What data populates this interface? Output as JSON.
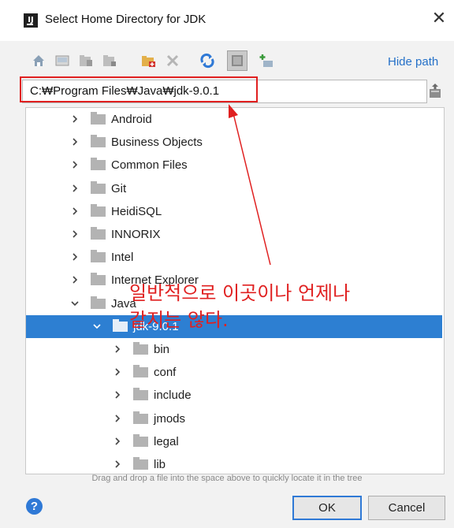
{
  "window": {
    "title": "Select Home Directory for JDK",
    "app_icon_text": "IJ",
    "close_glyph": "✕"
  },
  "toolbar": {
    "icons": [
      "home-icon",
      "desktop-icon",
      "project-icon",
      "module-icon",
      "new-folder-icon",
      "delete-icon",
      "refresh-icon",
      "show-hidden-icon",
      "expand-icon"
    ],
    "hide_path_label": "Hide path"
  },
  "path": {
    "value": "C:₩Program Files₩Java₩jdk-9.0.1"
  },
  "tree": {
    "items": [
      {
        "label": "Android",
        "level": 0,
        "expanded": false
      },
      {
        "label": "Business Objects",
        "level": 0,
        "expanded": false
      },
      {
        "label": "Common Files",
        "level": 0,
        "expanded": false
      },
      {
        "label": "Git",
        "level": 0,
        "expanded": false
      },
      {
        "label": "HeidiSQL",
        "level": 0,
        "expanded": false
      },
      {
        "label": "INNORIX",
        "level": 0,
        "expanded": false
      },
      {
        "label": "Intel",
        "level": 0,
        "expanded": false
      },
      {
        "label": "Internet Explorer",
        "level": 0,
        "expanded": false
      },
      {
        "label": "Java",
        "level": 0,
        "expanded": true
      },
      {
        "label": "jdk-9.0.1",
        "level": 1,
        "expanded": true,
        "selected": true
      },
      {
        "label": "bin",
        "level": 2,
        "expanded": false
      },
      {
        "label": "conf",
        "level": 2,
        "expanded": false
      },
      {
        "label": "include",
        "level": 2,
        "expanded": false
      },
      {
        "label": "jmods",
        "level": 2,
        "expanded": false
      },
      {
        "label": "legal",
        "level": 2,
        "expanded": false
      },
      {
        "label": "lib",
        "level": 2,
        "expanded": false
      }
    ]
  },
  "hint": "Drag and drop a file into the space above to quickly locate it in the tree",
  "buttons": {
    "help_label": "?",
    "ok_label": "OK",
    "cancel_label": "Cancel"
  },
  "annotation": {
    "line1": "일반적으로 이곳이나 언제나",
    "line2": "같지는 않다.",
    "color": "#e02020"
  },
  "colors": {
    "selection": "#2d7fd2",
    "accent": "#2470c8"
  }
}
